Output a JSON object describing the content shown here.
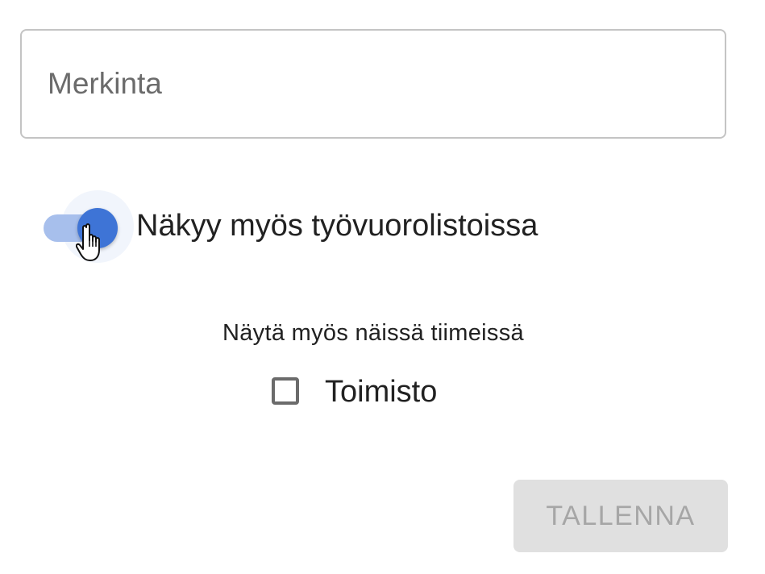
{
  "form": {
    "note_field": {
      "placeholder": "Merkinta",
      "value": ""
    },
    "visibility_switch": {
      "label": "Näkyy myös työvuorolistoissa",
      "checked": true,
      "accent_color": "#3e74d6"
    },
    "teams": {
      "title": "Näytä myös näissä tiimeissä",
      "items": [
        {
          "label": "Toimisto",
          "checked": false
        }
      ]
    },
    "save_button": {
      "label": "TALLENNA",
      "disabled": true
    }
  },
  "icons": {
    "cursor": "hand-pointer-icon",
    "checkbox": "checkbox-unchecked-icon"
  }
}
